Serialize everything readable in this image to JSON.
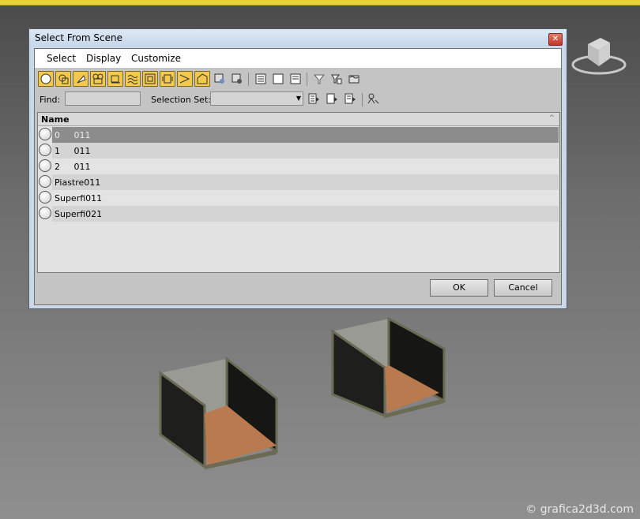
{
  "dialog": {
    "title": "Select From Scene",
    "close_symbol": "✕",
    "menu": [
      "Select",
      "Display",
      "Customize"
    ],
    "toolbar_icons": [
      "geometry-icon",
      "shapes-icon",
      "lights-icon",
      "cameras-icon",
      "helpers-icon",
      "spacewarps-icon",
      "groups-icon",
      "xrefs-icon",
      "bones-icon",
      "containers-icon",
      "frozen-icon",
      "hidden-icon",
      "display-all-icon",
      "display-none-icon",
      "display-invert-icon",
      "filter-icon",
      "filter-settings-icon",
      "layer-icon"
    ],
    "find_label": "Find:",
    "find_value": "",
    "selection_set_label": "Selection Set:",
    "selection_set_value": "",
    "list_header": "Name",
    "rows": [
      {
        "name": "0     011",
        "selected": true
      },
      {
        "name": "1     011",
        "selected": false
      },
      {
        "name": "2     011",
        "selected": false
      },
      {
        "name": "Piastre011",
        "selected": false
      },
      {
        "name": "Superfi011",
        "selected": false
      },
      {
        "name": "Superfi021",
        "selected": false
      }
    ],
    "ok_label": "OK",
    "cancel_label": "Cancel"
  },
  "watermark": "© grafica2d3d.com",
  "colors": {
    "toolbar_active": "#f2c94c",
    "viewport_top": "#4a4a4a",
    "viewport_bottom": "#8f8f8f",
    "floor": "#b87a4e",
    "wall": "#1c1c1a",
    "yellow_border": "#e8d23a"
  }
}
